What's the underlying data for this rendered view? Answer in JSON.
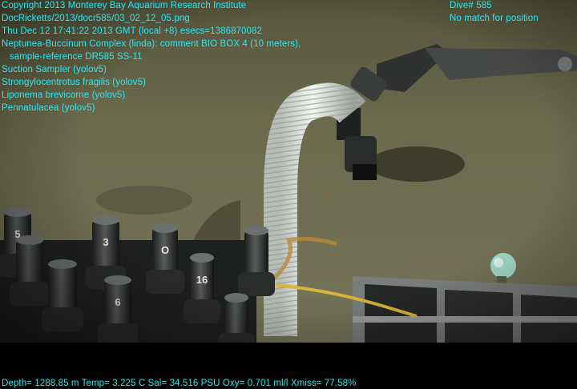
{
  "overlay": {
    "left_lines": [
      "Copyright 2013 Monterey Bay Aquarium Research Institute",
      "DocRicketts/2013/docr585/03_02_12_05.png",
      "Thu Dec 12 17:41:22 2013 GMT (local +8)  esecs=1386870082",
      "Neptunea-Buccinum Complex (linda): comment BIO BOX 4 (10 meters),",
      "   sample-reference DR585 SS-11",
      "Suction Sampler (yolov5)",
      "Strongylocentrotus fragilis (yolov5)",
      "Liponema brevicorne (yolov5)",
      "Pennatulacea (yolov5)"
    ],
    "right_lines": [
      "Dive# 585",
      "No match for position"
    ],
    "bottom_line": "Depth= 1288.85 m  Temp= 3.225 C  Sal= 34.516 PSU  Oxy= 0.701 ml/l  Xmiss= 77.58%"
  },
  "colors": {
    "overlay_text": "#2ee8f0",
    "seafloor": "#6b6a4c",
    "hose": "#e9ece8",
    "rope": "#d9b43a"
  },
  "cylinder_labels": [
    "3",
    "O",
    "16",
    "6",
    "5"
  ]
}
